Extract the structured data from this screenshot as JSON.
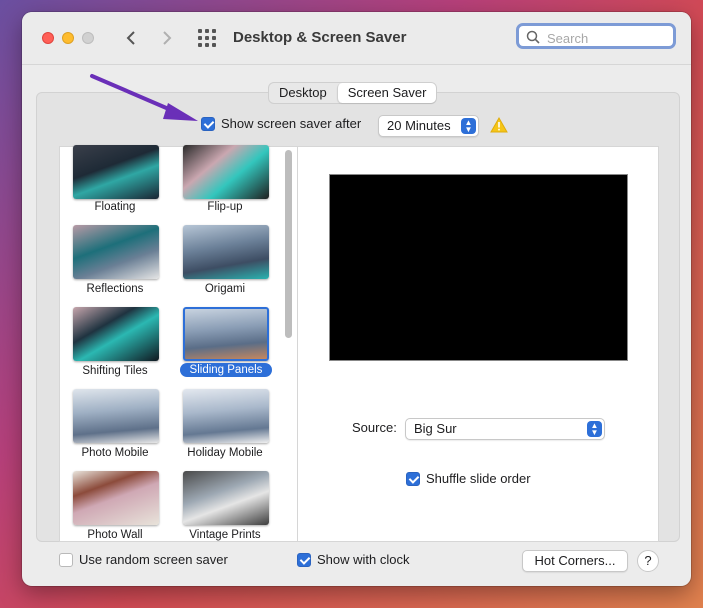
{
  "window": {
    "title": "Desktop & Screen Saver"
  },
  "search": {
    "placeholder": "Search"
  },
  "tabs": [
    {
      "label": "Desktop"
    },
    {
      "label": "Screen Saver"
    }
  ],
  "show_saver": {
    "label": "Show screen saver after",
    "checked": true,
    "value": "20 Minutes"
  },
  "savers": [
    {
      "label": "Floating"
    },
    {
      "label": "Flip-up"
    },
    {
      "label": "Reflections"
    },
    {
      "label": "Origami"
    },
    {
      "label": "Shifting Tiles"
    },
    {
      "label": "Sliding Panels",
      "selected": true
    },
    {
      "label": "Photo Mobile"
    },
    {
      "label": "Holiday Mobile"
    },
    {
      "label": "Photo Wall"
    },
    {
      "label": "Vintage Prints"
    }
  ],
  "source": {
    "label": "Source:",
    "value": "Big Sur"
  },
  "shuffle": {
    "label": "Shuffle slide order",
    "checked": true
  },
  "bottom": {
    "random_label": "Use random screen saver",
    "clock_label": "Show with clock",
    "hot_corners": "Hot Corners...",
    "help": "?"
  },
  "colors": {
    "accent": "#2d6fd8",
    "annotation_arrow": "#6a2fb8",
    "warning": "#f5c518"
  }
}
